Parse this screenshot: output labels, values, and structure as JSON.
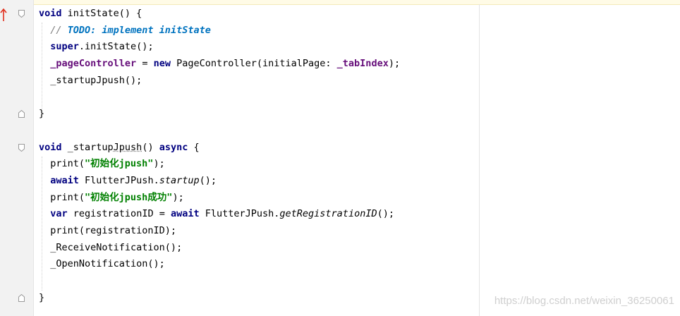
{
  "editor": {
    "lines": [
      [
        {
          "t": "void",
          "c": "kw"
        },
        {
          "t": " initState() {"
        }
      ],
      [
        {
          "t": "  // ",
          "c": "cm"
        },
        {
          "t": "TODO: implement initState",
          "c": "todo"
        }
      ],
      [
        {
          "t": "  "
        },
        {
          "t": "super",
          "c": "kw"
        },
        {
          "t": ".initState();"
        }
      ],
      [
        {
          "t": "  "
        },
        {
          "t": "_pageController",
          "c": "fld"
        },
        {
          "t": " = "
        },
        {
          "t": "new",
          "c": "kw"
        },
        {
          "t": " PageController(initialPage: "
        },
        {
          "t": "_tabIndex",
          "c": "fld"
        },
        {
          "t": ");"
        }
      ],
      [
        {
          "t": "  _startupJpush();"
        }
      ],
      [
        {
          "t": ""
        }
      ],
      [
        {
          "t": "}"
        }
      ],
      [
        {
          "t": ""
        }
      ],
      [
        {
          "t": "void",
          "c": "kw"
        },
        {
          "t": " _startup"
        },
        {
          "t": "Jpush",
          "c": "squiggle"
        },
        {
          "t": "() "
        },
        {
          "t": "async",
          "c": "kw"
        },
        {
          "t": " {"
        }
      ],
      [
        {
          "t": "  print("
        },
        {
          "t": "\"初始化jpush\"",
          "c": "str"
        },
        {
          "t": ");"
        }
      ],
      [
        {
          "t": "  "
        },
        {
          "t": "await",
          "c": "kw"
        },
        {
          "t": " FlutterJPush."
        },
        {
          "t": "startup",
          "c": "it"
        },
        {
          "t": "();"
        }
      ],
      [
        {
          "t": "  print("
        },
        {
          "t": "\"初始化jpush成功\"",
          "c": "str"
        },
        {
          "t": ");"
        }
      ],
      [
        {
          "t": "  "
        },
        {
          "t": "var",
          "c": "kw"
        },
        {
          "t": " registrationID = "
        },
        {
          "t": "await",
          "c": "kw"
        },
        {
          "t": " FlutterJPush."
        },
        {
          "t": "getRegistrationID",
          "c": "it"
        },
        {
          "t": "();"
        }
      ],
      [
        {
          "t": "  print(registrationID);"
        }
      ],
      [
        {
          "t": "  _ReceiveNotification();"
        }
      ],
      [
        {
          "t": "  _OpenNotification();"
        }
      ],
      [
        {
          "t": ""
        }
      ],
      [
        {
          "t": "}"
        }
      ]
    ]
  },
  "watermark": "https://blog.csdn.net/weixin_36250061",
  "colors": {
    "keyword": "#000080",
    "string": "#008000",
    "field": "#660e7a",
    "todo": "#0073bf",
    "comment": "#808080",
    "override_marker": "#e0301e"
  },
  "icons": [
    "override-method-icon",
    "fold-marker-icon"
  ]
}
